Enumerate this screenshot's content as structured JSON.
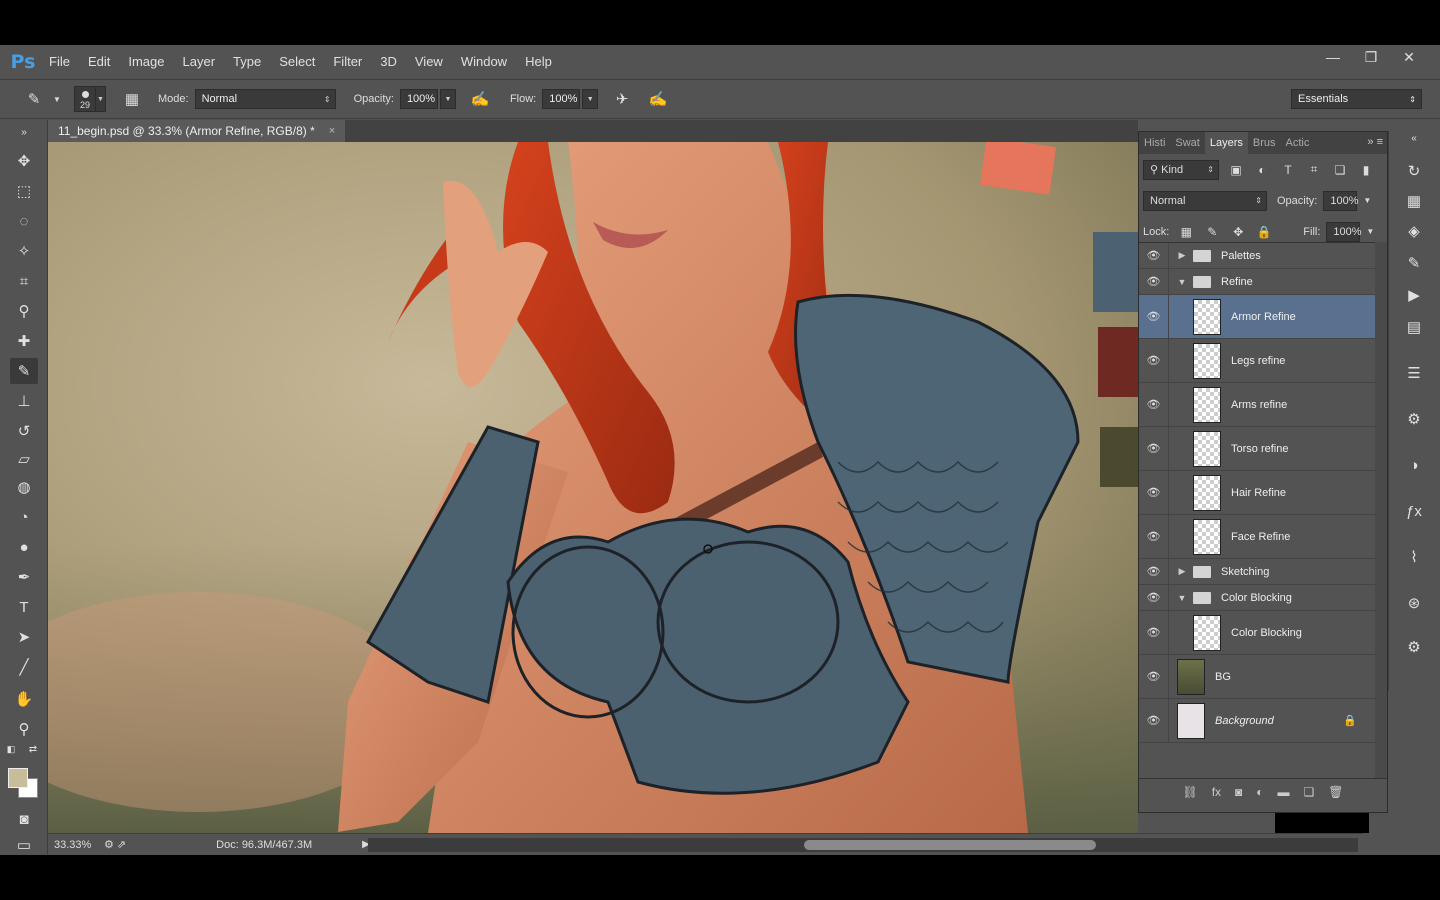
{
  "app": {
    "logo": "Ps",
    "menu": [
      "File",
      "Edit",
      "Image",
      "Layer",
      "Type",
      "Select",
      "Filter",
      "3D",
      "View",
      "Window",
      "Help"
    ],
    "window_controls": [
      "minimize",
      "maximize",
      "close"
    ]
  },
  "options": {
    "brush_size": "29",
    "mode_label": "Mode:",
    "mode_value": "Normal",
    "opacity_label": "Opacity:",
    "opacity_value": "100%",
    "flow_label": "Flow:",
    "flow_value": "100%",
    "workspace": "Essentials"
  },
  "document": {
    "tab_title": "11_begin.psd @ 33.3% (Armor Refine, RGB/8) *",
    "close": "×"
  },
  "status": {
    "zoom": "33.33%",
    "doc": "Doc: 96.3M/467.3M"
  },
  "layers_panel": {
    "tabs": [
      "Histi",
      "Swat",
      "Layers",
      "Brus",
      "Actic"
    ],
    "active_tab": "Layers",
    "filter_kind": "Kind",
    "blend_mode": "Normal",
    "opacity_label": "Opacity:",
    "opacity_value": "100%",
    "lock_label": "Lock:",
    "fill_label": "Fill:",
    "fill_value": "100%",
    "layers": [
      {
        "name": "Palettes",
        "type": "group",
        "expanded": false,
        "indent": 0
      },
      {
        "name": "Refine",
        "type": "group",
        "expanded": true,
        "indent": 0
      },
      {
        "name": "Armor Refine",
        "type": "layer",
        "selected": true,
        "indent": 1
      },
      {
        "name": "Legs refine",
        "type": "layer",
        "indent": 1
      },
      {
        "name": "Arms refine",
        "type": "layer",
        "indent": 1
      },
      {
        "name": "Torso refine",
        "type": "layer",
        "indent": 1
      },
      {
        "name": "Hair Refine",
        "type": "layer",
        "indent": 1
      },
      {
        "name": "Face Refine",
        "type": "layer",
        "indent": 1
      },
      {
        "name": "Sketching",
        "type": "group",
        "expanded": false,
        "indent": 0
      },
      {
        "name": "Color Blocking",
        "type": "group",
        "expanded": true,
        "indent": 0
      },
      {
        "name": "Color Blocking",
        "type": "layer",
        "indent": 1
      },
      {
        "name": "BG",
        "type": "layer",
        "indent": 0
      },
      {
        "name": "Background",
        "type": "background",
        "locked": true,
        "indent": 0
      }
    ]
  },
  "colors": {
    "foreground": "#c7bd9a",
    "background": "#ffffff",
    "selected_layer": "#5a708f"
  }
}
